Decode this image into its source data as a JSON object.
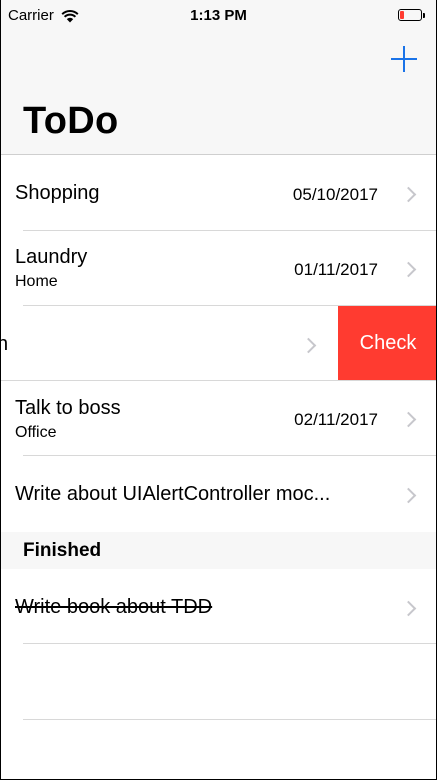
{
  "status_bar": {
    "carrier": "Carrier",
    "time": "1:13 PM",
    "battery_color": "#ff3b30"
  },
  "nav": {
    "title": "ToDo",
    "add_icon": "plus-icon",
    "accent": "#1a73e8"
  },
  "items": [
    {
      "title": "Shopping",
      "subtitle": "",
      "date": "05/10/2017"
    },
    {
      "title": "Laundry",
      "subtitle": "Home",
      "date": "01/11/2017"
    },
    {
      "title": "h",
      "subtitle": "",
      "date": "",
      "swipe_action": "Check"
    },
    {
      "title": "Talk to boss",
      "subtitle": "Office",
      "date": "02/11/2017"
    },
    {
      "title": "Write about UIAlertController moc...",
      "subtitle": "",
      "date": ""
    }
  ],
  "finished_section": {
    "header": "Finished",
    "items": [
      {
        "title": "Write book about TDD"
      }
    ]
  }
}
